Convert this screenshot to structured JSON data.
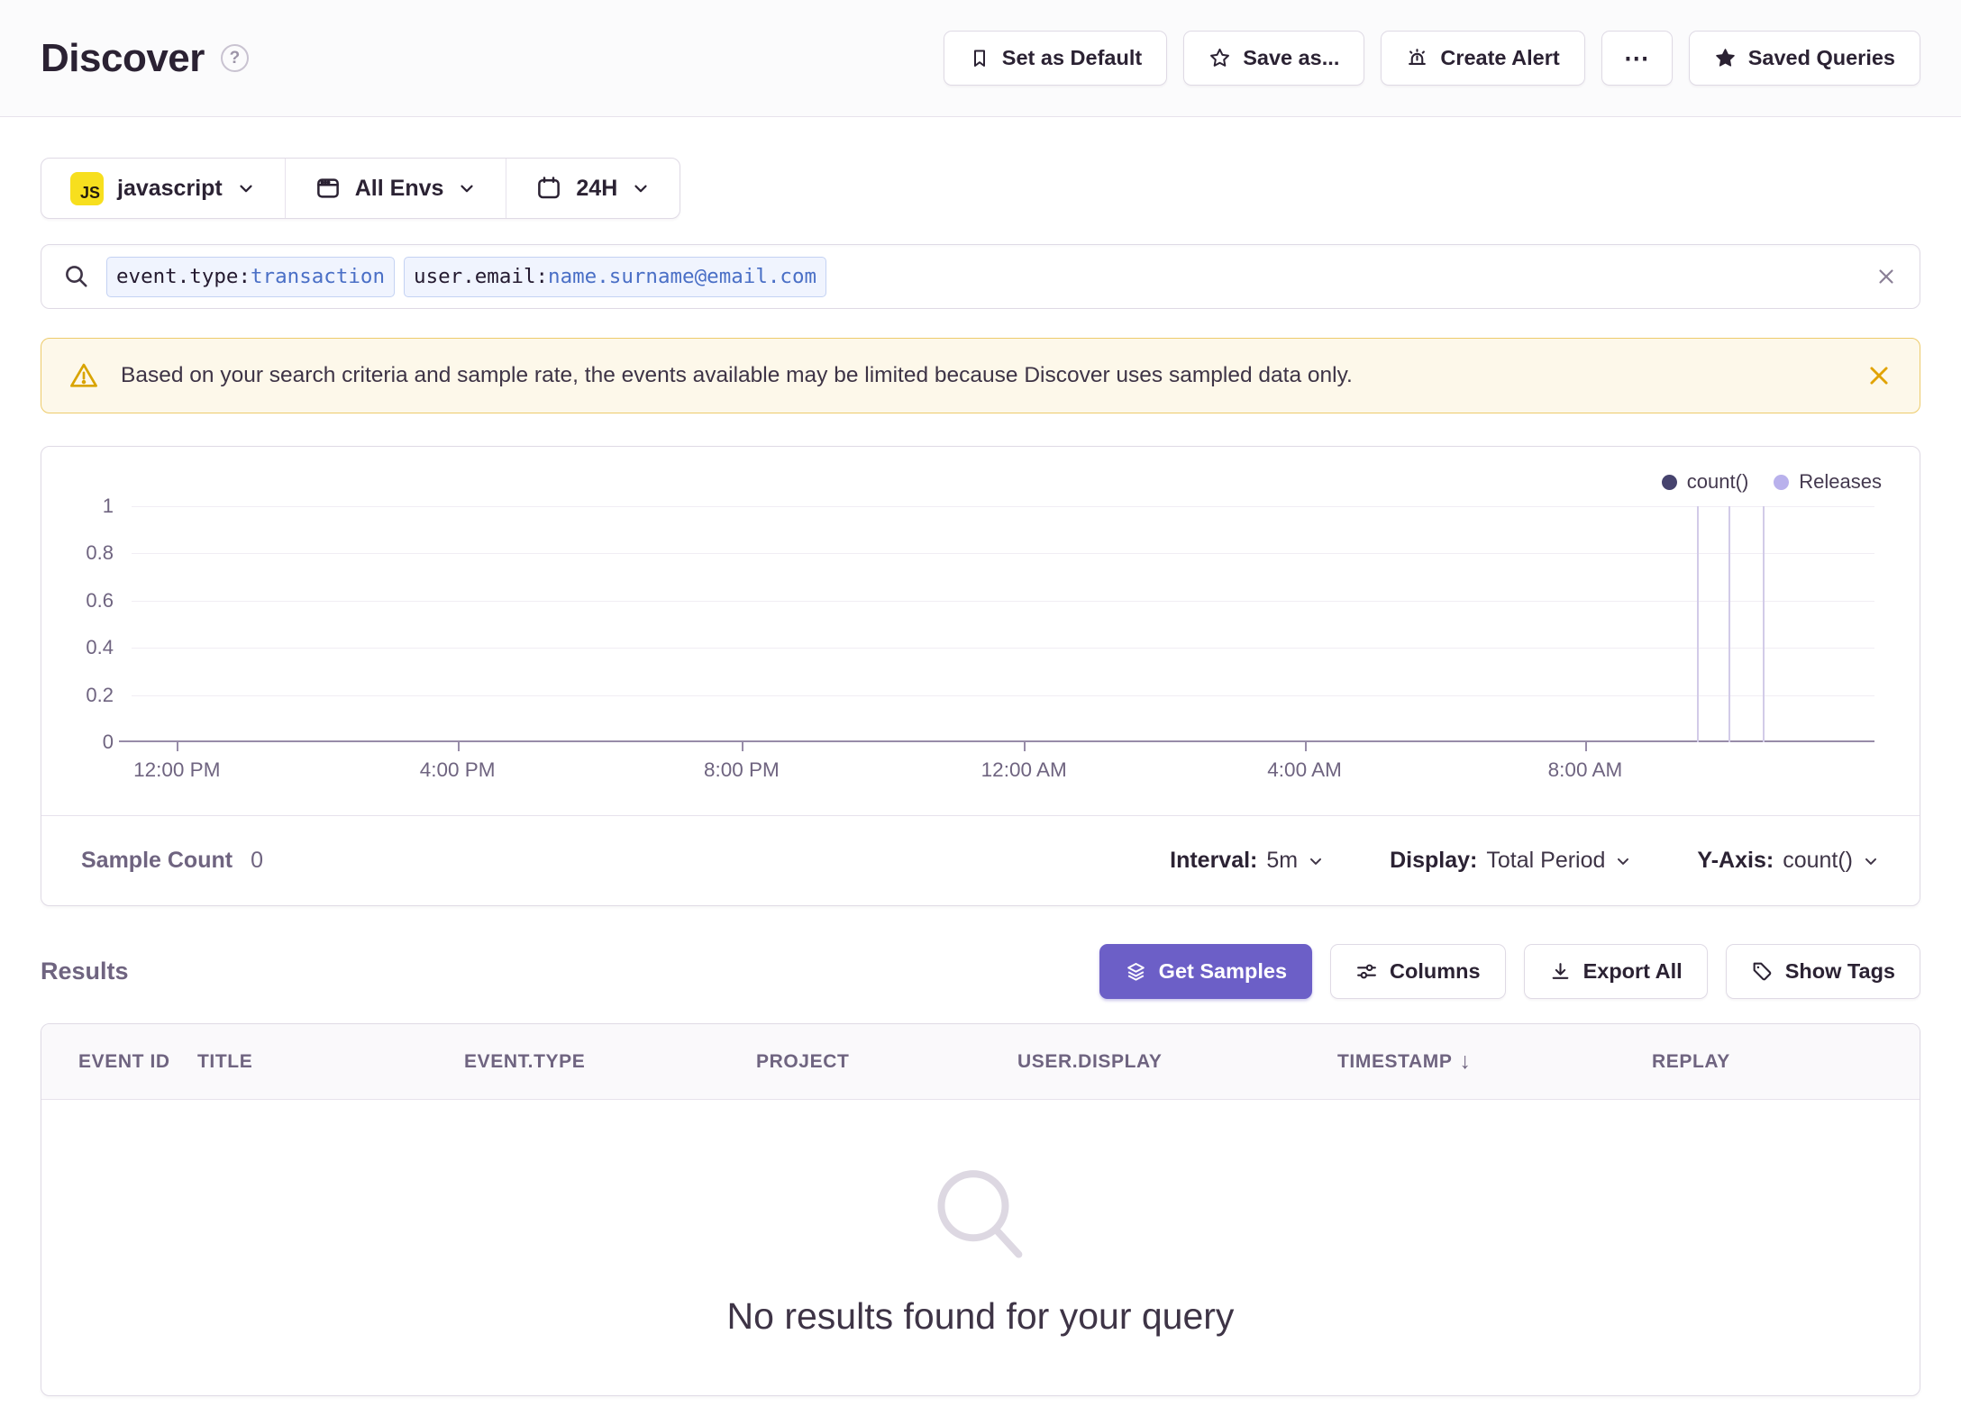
{
  "header": {
    "title": "Discover",
    "buttons": [
      {
        "label": "Set as Default"
      },
      {
        "label": "Save as..."
      },
      {
        "label": "Create Alert"
      },
      {
        "label": "⋯"
      },
      {
        "label": "Saved Queries"
      }
    ]
  },
  "filters": {
    "project": {
      "badge": "JS",
      "label": "javascript"
    },
    "environment": {
      "label": "All Envs"
    },
    "time": {
      "label": "24H"
    }
  },
  "search": {
    "tokens": [
      {
        "key": "event.type:",
        "value": "transaction"
      },
      {
        "key": "user.email:",
        "value": "name.surname@email.com"
      }
    ]
  },
  "banner": {
    "text": "Based on your search criteria and sample rate, the events available may be limited because Discover uses sampled data only."
  },
  "chart_data": {
    "type": "line",
    "title": "",
    "series": [
      {
        "name": "count()",
        "color": "#46436E",
        "values": []
      }
    ],
    "ylim": [
      0,
      1
    ],
    "y_ticks": [
      0,
      0.2,
      0.4,
      0.6,
      0.8,
      1
    ],
    "x_ticks": [
      {
        "label": "12:00 PM",
        "pos": 0.026
      },
      {
        "label": "4:00 PM",
        "pos": 0.187
      },
      {
        "label": "8:00 PM",
        "pos": 0.35
      },
      {
        "label": "12:00 AM",
        "pos": 0.512
      },
      {
        "label": "4:00 AM",
        "pos": 0.673
      },
      {
        "label": "8:00 AM",
        "pos": 0.834
      }
    ],
    "legend": [
      {
        "label": "count()",
        "color": "#46436E"
      },
      {
        "label": "Releases",
        "color": "#B9B1EC"
      }
    ],
    "legend_position": "top-right",
    "grid": true,
    "release_markers_pos": [
      0.898,
      0.916,
      0.936
    ],
    "sample_count": 0
  },
  "chart_footer": {
    "sample_count_label": "Sample Count",
    "sample_count_value": "0",
    "interval_label": "Interval:",
    "interval_value": "5m",
    "display_label": "Display:",
    "display_value": "Total Period",
    "yaxis_label": "Y-Axis:",
    "yaxis_value": "count()"
  },
  "results": {
    "title": "Results",
    "get_samples_label": "Get Samples",
    "columns_label": "Columns",
    "export_all_label": "Export All",
    "show_tags_label": "Show Tags"
  },
  "table": {
    "headers": [
      "EVENT ID",
      "TITLE",
      "EVENT.TYPE",
      "PROJECT",
      "USER.DISPLAY",
      "TIMESTAMP",
      "REPLAY"
    ],
    "sort_column": "TIMESTAMP",
    "sort_direction": "desc",
    "empty_text": "No results found for your query"
  },
  "colors": {
    "accent_purple": "#6C5FC7",
    "warning_amber": "#D9A400",
    "token_value_blue": "#4A6FC6",
    "js_badge_yellow": "#F7DF1E",
    "release_line": "#D2CBE8",
    "count_series": "#46436E",
    "releases_series": "#B9B1EC"
  }
}
